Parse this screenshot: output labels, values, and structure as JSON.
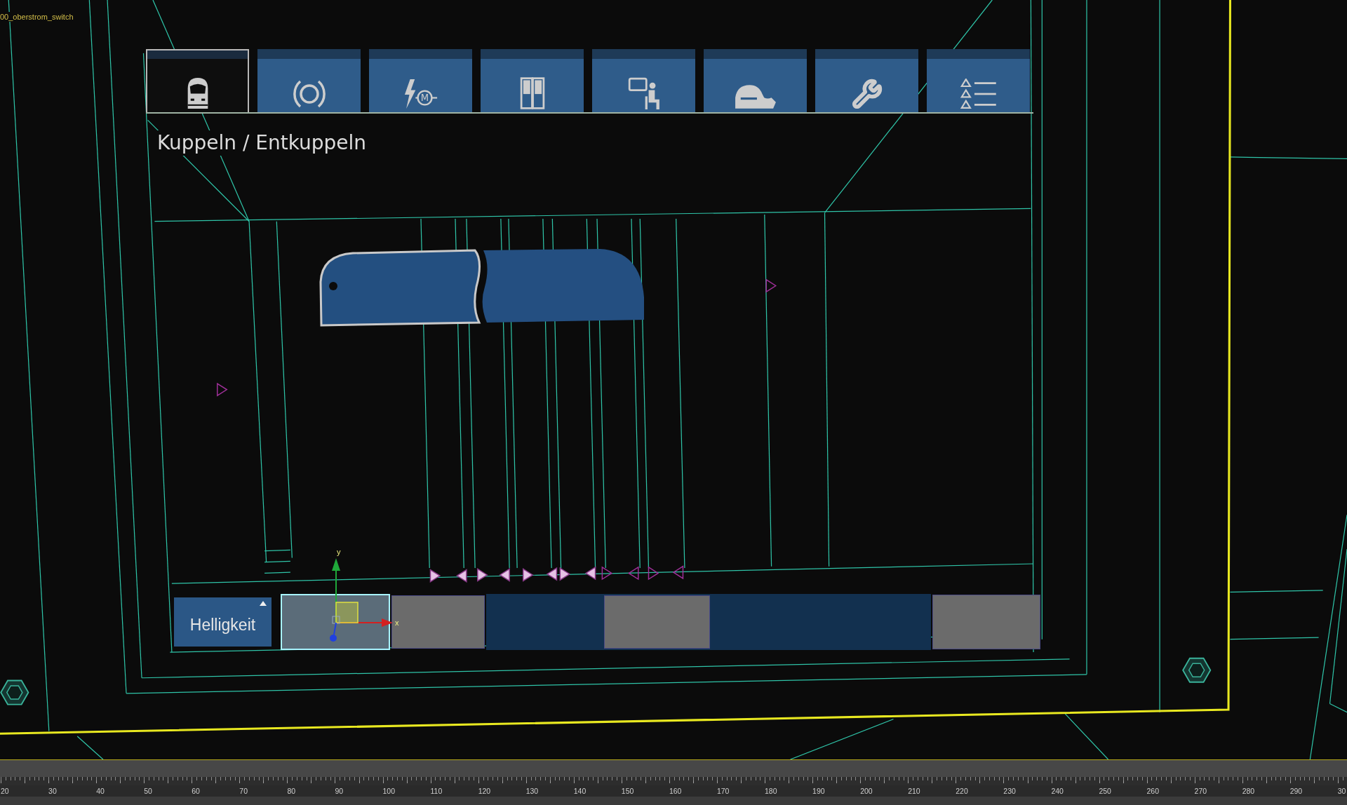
{
  "viewport": {
    "object_label": "00_oberstrom_switch"
  },
  "display": {
    "tabs": [
      {
        "selected": true
      },
      {
        "selected": false
      },
      {
        "selected": false,
        "symbol": "M"
      },
      {
        "selected": false
      },
      {
        "selected": false
      },
      {
        "selected": false
      },
      {
        "selected": false
      },
      {
        "selected": false
      }
    ],
    "title": "Kuppeln / Entkuppeln",
    "train": {
      "cars": [
        {
          "selected": true
        },
        {
          "selected": false
        }
      ]
    },
    "bottom_bar": {
      "button": {
        "label": "Helligkeit"
      },
      "boxes": [
        {
          "selected": true
        },
        {
          "selected": false
        },
        {
          "selected": false
        },
        {
          "selected": false
        }
      ]
    },
    "gizmo": {
      "x_label": "x",
      "y_label": "y"
    }
  },
  "timeline": {
    "labels": [
      "20",
      "30",
      "40",
      "50",
      "60",
      "70",
      "80",
      "90",
      "100",
      "110",
      "120",
      "130",
      "140",
      "150",
      "160",
      "170",
      "180",
      "190",
      "200",
      "210",
      "220",
      "230",
      "240",
      "250",
      "260",
      "270",
      "280",
      "290",
      "30"
    ]
  }
}
